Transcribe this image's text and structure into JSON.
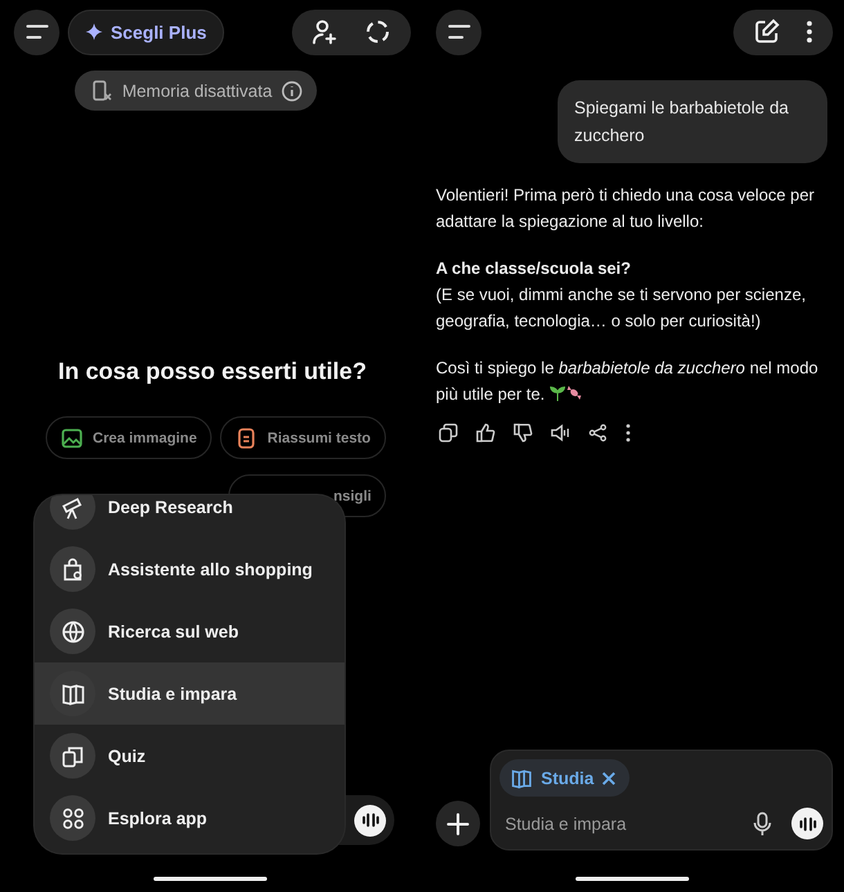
{
  "left": {
    "plus_button": "Scegli Plus",
    "memory_chip": "Memoria disattivata",
    "greeting": "In cosa posso esserti utile?",
    "suggestions": [
      {
        "label": "Crea immagine",
        "kind": "image",
        "color": "#4caf50"
      },
      {
        "label": "Riassumi testo",
        "kind": "doc",
        "color": "#e8825a"
      },
      {
        "label": "nsigli",
        "kind": "partial"
      }
    ],
    "menu": [
      {
        "label": "Deep Research",
        "kind": "telescope",
        "selected": false
      },
      {
        "label": "Assistente allo shopping",
        "kind": "bag",
        "selected": false
      },
      {
        "label": "Ricerca sul web",
        "kind": "globe",
        "selected": false
      },
      {
        "label": "Studia e impara",
        "kind": "book",
        "selected": true
      },
      {
        "label": "Quiz",
        "kind": "cards",
        "selected": false
      },
      {
        "label": "Esplora app",
        "kind": "apps",
        "selected": false
      }
    ]
  },
  "right": {
    "user_message": "Spiegami le barbabietole da zucchero",
    "reply": [
      "Volentieri! Prima però ti chiedo una cosa veloce per adattare la spiegazione al tuo livello:",
      "**A che classe/scuola sei?**\n(E se vuoi, dimmi anche se ti servono per scienze, geografia, tecnologia… o solo per curiosità!)",
      "Così ti spiego le *barbabietole da zucchero* nel modo più utile per te."
    ],
    "tool_chip": "Studia",
    "composer": {
      "placeholder": "Studia e impara"
    }
  }
}
